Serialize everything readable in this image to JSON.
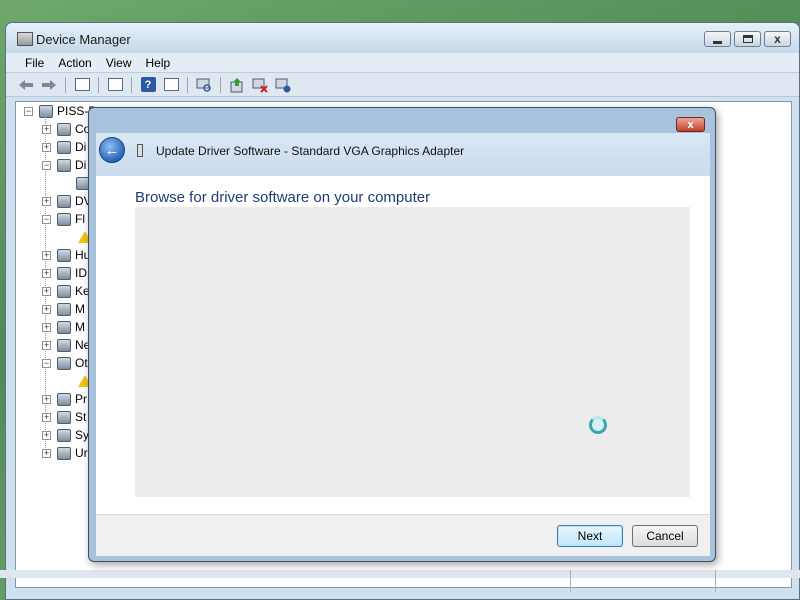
{
  "window": {
    "title": "Device Manager",
    "caption_min": "",
    "caption_max": "",
    "caption_close": "x"
  },
  "menu": [
    "File",
    "Action",
    "View",
    "Help"
  ],
  "toolbar": {
    "icons": [
      "back-arrow-icon",
      "forward-arrow-icon",
      "properties-icon",
      "view-icon",
      "help-icon",
      "show-icon",
      "scan-icon",
      "update-driver-icon",
      "disable-icon",
      "uninstall-icon"
    ],
    "help_glyph": "?"
  },
  "tree": {
    "root_label": "PISS-P",
    "nodes": [
      {
        "label": "Co",
        "expander": "+"
      },
      {
        "label": "Di",
        "expander": "+"
      },
      {
        "label": "Di",
        "expander": "−"
      },
      {
        "label": "",
        "expander": ""
      },
      {
        "label": "DV",
        "expander": "+"
      },
      {
        "label": "Fl",
        "expander": "−"
      },
      {
        "label": "",
        "expander": ""
      },
      {
        "label": "Hu",
        "expander": "+"
      },
      {
        "label": "ID",
        "expander": "+"
      },
      {
        "label": "Ke",
        "expander": "+"
      },
      {
        "label": "M",
        "expander": "+"
      },
      {
        "label": "M",
        "expander": "+"
      },
      {
        "label": "Ne",
        "expander": "+"
      },
      {
        "label": "Ot",
        "expander": "−"
      },
      {
        "label": "",
        "expander": ""
      },
      {
        "label": "Pr",
        "expander": "+"
      },
      {
        "label": "St",
        "expander": "+"
      },
      {
        "label": "Sy",
        "expander": "+"
      },
      {
        "label": "Ur",
        "expander": "+"
      }
    ]
  },
  "dialog": {
    "title": "Update Driver Software - Standard VGA Graphics Adapter",
    "close_glyph": "x",
    "back_glyph": "←",
    "heading": "Browse for driver software on your computer",
    "buttons": {
      "next": "Next",
      "cancel": "Cancel"
    }
  },
  "colors": {
    "heading": "#1f3c78",
    "dialog_frame": "#a9c3dd",
    "spinner": "#3aa7b0"
  }
}
